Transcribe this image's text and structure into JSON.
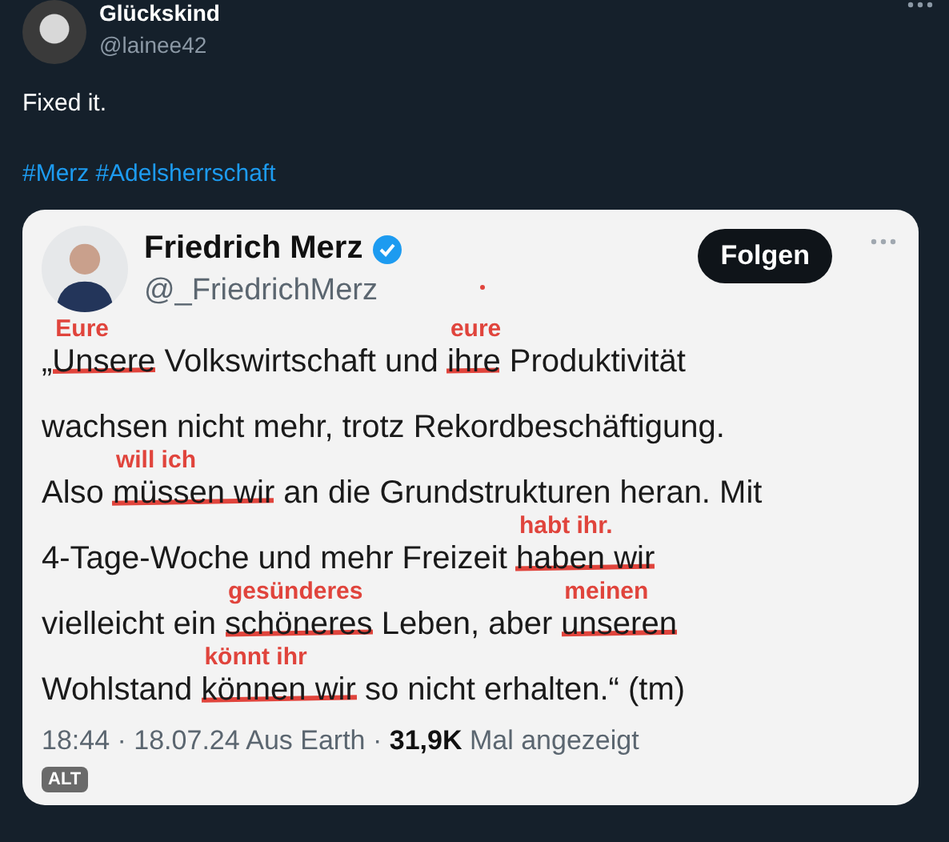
{
  "author": {
    "name": "Glückskind",
    "handle": "@lainee42"
  },
  "text": "Fixed it.",
  "hashtags": [
    "#Merz",
    "#Adelsherrschaft"
  ],
  "embedded": {
    "kind": "screenshot",
    "name": "Friedrich Merz",
    "verified": true,
    "handle": "@_FriedrichMerz",
    "follow_button": "Folgen",
    "lines": [
      [
        {
          "text": "„"
        },
        {
          "text": "Unsere",
          "struck": true,
          "correction": "Eure"
        },
        {
          "text": " Volkswirtschaft und "
        },
        {
          "text": "ihre",
          "struck": true,
          "correction": "eure"
        },
        {
          "text": " Produktivität"
        }
      ],
      [
        {
          "text": "wachsen nicht mehr, trotz Rekordbeschäftigung."
        }
      ],
      [
        {
          "text": "Also "
        },
        {
          "text": "müssen wir",
          "struck": true,
          "correction": "will ich"
        },
        {
          "text": " an die Grundstrukturen heran. Mit"
        }
      ],
      [
        {
          "text": "4-Tage-Woche und mehr Freizeit "
        },
        {
          "text": "haben wir",
          "struck": true,
          "correction": "habt ihr."
        }
      ],
      [
        {
          "text": "vielleicht ein "
        },
        {
          "text": "schöneres",
          "struck": true,
          "correction": "gesünderes"
        },
        {
          "text": " Leben, aber "
        },
        {
          "text": "unseren",
          "struck": true,
          "correction": "meinen"
        }
      ],
      [
        {
          "text": "Wohlstand "
        },
        {
          "text": "können wir",
          "struck": true,
          "correction": "könnt ihr"
        },
        {
          "text": " so nicht erhalten.“ (tm)"
        }
      ]
    ],
    "meta": "18:44 · 18.07.24 Aus Earth · ",
    "views": "31,9K",
    "views_label": " Mal angezeigt"
  },
  "alt_badge": "ALT"
}
